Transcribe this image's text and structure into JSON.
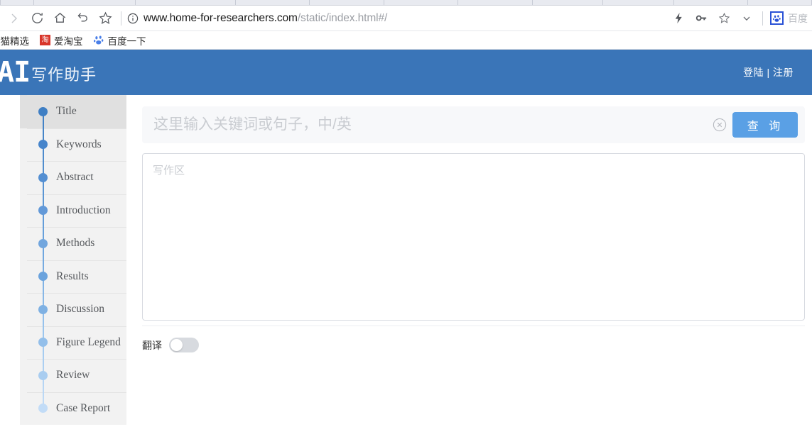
{
  "browser": {
    "tab_count": 10,
    "nav_icons": [
      "forward-icon",
      "reload-icon",
      "home-icon",
      "back-arrow-icon",
      "star-icon"
    ],
    "url": {
      "info_icon": "info-circle-icon",
      "domain": "www.home-for-researchers.com",
      "path": "/static/index.html#/"
    },
    "right_icons": [
      "lightning-icon",
      "key-icon",
      "star-outline-icon",
      "chevron-down-icon"
    ],
    "search_engine": {
      "icon": "baidu-paw-icon",
      "label": "百度"
    },
    "bookmarks": [
      {
        "icon": "",
        "label": "天猫精选"
      },
      {
        "icon": "taobao-icon",
        "icon_char": "淘",
        "label": "爱淘宝"
      },
      {
        "icon": "baidu-paw-icon",
        "label": "百度一下"
      }
    ]
  },
  "header": {
    "logo_text": "AI",
    "logo_subtitle": "写作助手",
    "auth": "登陆 | 注册",
    "background_color": "#3a75b8"
  },
  "sidebar": {
    "active_index": 0,
    "items": [
      {
        "label": "Title",
        "dot_color": "#3f7fc4"
      },
      {
        "label": "Keywords",
        "dot_color": "#4785cb"
      },
      {
        "label": "Abstract",
        "dot_color": "#548fd2"
      },
      {
        "label": "Introduction",
        "dot_color": "#6299d8"
      },
      {
        "label": "Methods",
        "dot_color": "#72a6de"
      },
      {
        "label": "Results",
        "dot_color": "#6ba3dd"
      },
      {
        "label": "Discussion",
        "dot_color": "#7fb1e3"
      },
      {
        "label": "Figure Legend",
        "dot_color": "#93bfea"
      },
      {
        "label": "Review",
        "dot_color": "#a9cdf0"
      },
      {
        "label": "Case Report",
        "dot_color": "#c2dcf7"
      }
    ]
  },
  "main": {
    "search": {
      "value": "",
      "placeholder": "这里输入关键词或句子，中/英",
      "clear_icon": "clear-circle-icon",
      "query_button": "查 询",
      "query_button_color": "#5aa0e5"
    },
    "editor": {
      "value": "",
      "placeholder": "写作区"
    },
    "translate": {
      "label": "翻译",
      "enabled": false
    }
  }
}
